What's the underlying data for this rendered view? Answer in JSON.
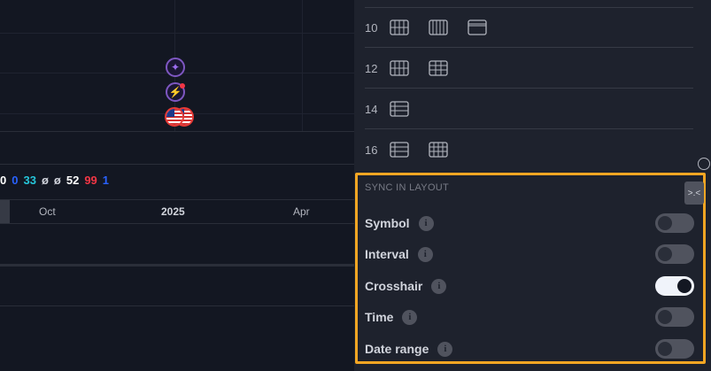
{
  "chart": {
    "values": [
      {
        "text": "0",
        "color": "#ffffff"
      },
      {
        "text": "0",
        "color": "#2962ff"
      },
      {
        "text": "33",
        "color": "#26c6da"
      },
      {
        "text": "ø",
        "color": "#d1d4dc"
      },
      {
        "text": "ø",
        "color": "#d1d4dc"
      },
      {
        "text": "52",
        "color": "#ffffff"
      },
      {
        "text": "99",
        "color": "#f23645"
      },
      {
        "text": "1",
        "color": "#2962ff"
      }
    ],
    "time_axis": {
      "labels": [
        "Oct",
        "2025",
        "Apr"
      ]
    }
  },
  "layout_panel": {
    "rows": [
      {
        "count": "10",
        "icons": [
          "grid-10-cols-icon",
          "grid-10-vertical-icon",
          "grid-10-horizontal-icon"
        ]
      },
      {
        "count": "12",
        "icons": [
          "grid-12-a-icon",
          "grid-12-b-icon"
        ]
      },
      {
        "count": "14",
        "icons": [
          "grid-14-icon"
        ]
      },
      {
        "count": "16",
        "icons": [
          "grid-16-a-icon",
          "grid-16-b-icon"
        ]
      }
    ]
  },
  "sync": {
    "title": "SYNC IN LAYOUT",
    "items": [
      {
        "label": "Symbol",
        "enabled": false
      },
      {
        "label": "Interval",
        "enabled": false
      },
      {
        "label": "Crosshair",
        "enabled": true
      },
      {
        "label": "Time",
        "enabled": false
      },
      {
        "label": "Date range",
        "enabled": false
      }
    ],
    "info_glyph": "i",
    "collapse_glyph": ">.<"
  },
  "colors": {
    "accent_highlight": "#f5a623",
    "background": "#131722",
    "panel": "#1e222d"
  }
}
